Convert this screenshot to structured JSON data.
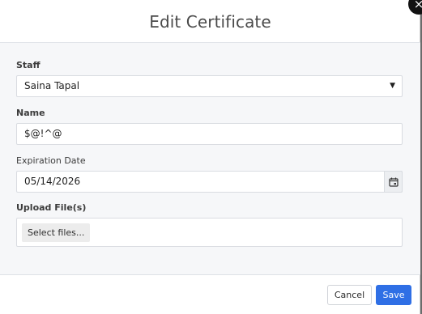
{
  "dialog": {
    "title": "Edit Certificate",
    "close_symbol": "×"
  },
  "form": {
    "staff": {
      "label": "Staff",
      "value": "Saina Tapal",
      "arrow": "▼"
    },
    "name": {
      "label": "Name",
      "value": "$@!^@"
    },
    "expiration": {
      "label": "Expiration Date",
      "value": "05/14/2026",
      "icon": "calendar-icon"
    },
    "upload": {
      "label": "Upload File(s)",
      "button_label": "Select files..."
    }
  },
  "footer": {
    "cancel_label": "Cancel",
    "save_label": "Save"
  },
  "colors": {
    "accent": "#2f6fe5",
    "body_bg": "#f6f7f9"
  }
}
